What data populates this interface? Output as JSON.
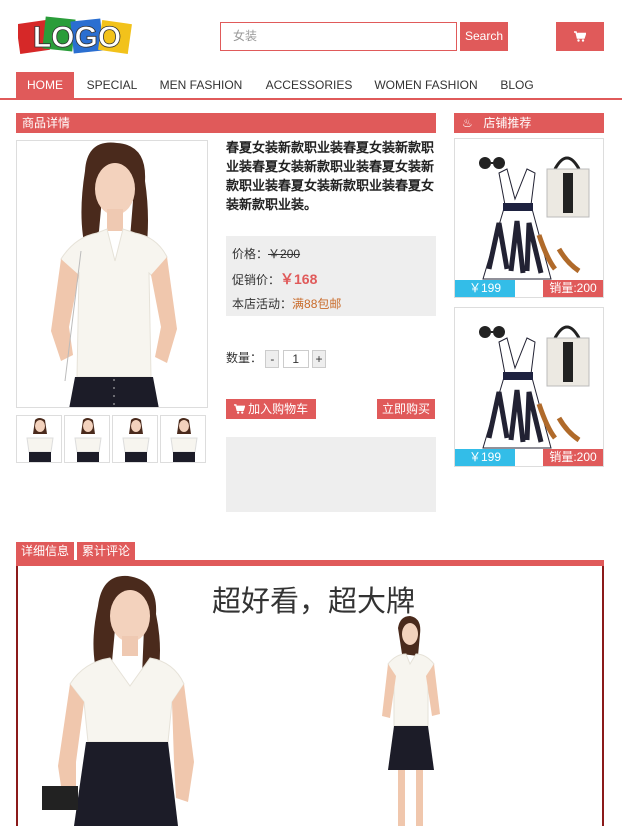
{
  "header": {
    "logo_text": "LOGO",
    "search_placeholder": "女装",
    "search_button": "Search",
    "cart_icon": "cart-icon"
  },
  "nav": {
    "items": [
      "HOME",
      "SPECIAL",
      "MEN FASHION",
      "ACCESSORIES",
      "WOMEN FASHION",
      "BLOG"
    ],
    "active": "HOME"
  },
  "product": {
    "section_title": "商品详情",
    "title": "春夏女装新款职业装春夏女装新款职业装春夏女装新款职业装春夏女装新款职业装春夏女装新款职业装春夏女装新款职业装。",
    "price_label": "价格：",
    "price": "￥200",
    "promo_label": "促销价：",
    "promo_price": "￥168",
    "activity_label": "本店活动：",
    "activity": "满88包邮",
    "qty_label": "数量：",
    "qty_minus": "-",
    "qty_value": "1",
    "qty_plus": "+",
    "add_to_cart": "加入购物车",
    "buy_now": "立即购买"
  },
  "recommend": {
    "title": "店铺推荐",
    "items": [
      {
        "price": "￥199",
        "sales": "销量:200"
      },
      {
        "price": "￥199",
        "sales": "销量:200"
      }
    ]
  },
  "detail": {
    "tabs": [
      "详细信息",
      "累计评论"
    ],
    "slogan": "超好看，超大牌"
  },
  "colors": {
    "accent": "#e05a5a",
    "price_tag": "#33bde8",
    "dark_border": "#8b1a1a"
  }
}
